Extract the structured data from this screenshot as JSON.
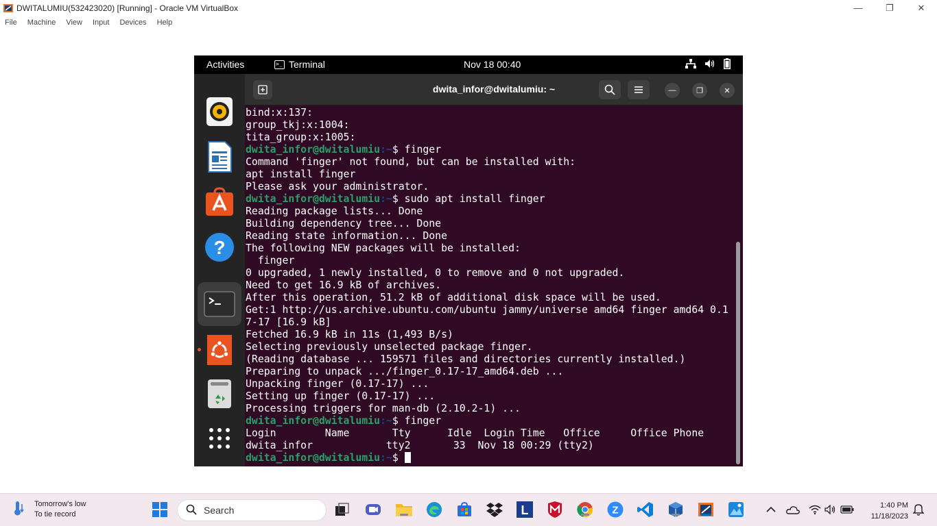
{
  "vbox": {
    "title": "DWITALUMIU(532423020) [Running] - Oracle VM VirtualBox",
    "menu": [
      "File",
      "Machine",
      "View",
      "Input",
      "Devices",
      "Help"
    ]
  },
  "gnome": {
    "activities": "Activities",
    "app_name": "Terminal",
    "clock": "Nov 18  00:40"
  },
  "terminal": {
    "title": "dwita_infor@dwitalumiu: ~",
    "prompt_user": "dwita_infor@dwitalumiu",
    "prompt_path": ":~",
    "prompt_symbol": "$ ",
    "lines": [
      {
        "type": "out",
        "text": "bind:x:137:"
      },
      {
        "type": "out",
        "text": "group_tkj:x:1004:"
      },
      {
        "type": "out",
        "text": "tita_group:x:1005:"
      },
      {
        "type": "cmd",
        "text": "finger"
      },
      {
        "type": "out",
        "text": "Command 'finger' not found, but can be installed with:"
      },
      {
        "type": "out",
        "text": "apt install finger"
      },
      {
        "type": "out",
        "text": "Please ask your administrator."
      },
      {
        "type": "cmd",
        "text": "sudo apt install finger"
      },
      {
        "type": "out",
        "text": "Reading package lists... Done"
      },
      {
        "type": "out",
        "text": "Building dependency tree... Done"
      },
      {
        "type": "out",
        "text": "Reading state information... Done"
      },
      {
        "type": "out",
        "text": "The following NEW packages will be installed:"
      },
      {
        "type": "out",
        "text": "  finger"
      },
      {
        "type": "out",
        "text": "0 upgraded, 1 newly installed, 0 to remove and 0 not upgraded."
      },
      {
        "type": "out",
        "text": "Need to get 16.9 kB of archives."
      },
      {
        "type": "out",
        "text": "After this operation, 51.2 kB of additional disk space will be used."
      },
      {
        "type": "out",
        "text": "Get:1 http://us.archive.ubuntu.com/ubuntu jammy/universe amd64 finger amd64 0.1"
      },
      {
        "type": "out",
        "text": "7-17 [16.9 kB]"
      },
      {
        "type": "out",
        "text": "Fetched 16.9 kB in 11s (1,493 B/s)"
      },
      {
        "type": "out",
        "text": "Selecting previously unselected package finger."
      },
      {
        "type": "out",
        "text": "(Reading database ... 159571 files and directories currently installed.)"
      },
      {
        "type": "out",
        "text": "Preparing to unpack .../finger_0.17-17_amd64.deb ..."
      },
      {
        "type": "out",
        "text": "Unpacking finger (0.17-17) ..."
      },
      {
        "type": "out",
        "text": "Setting up finger (0.17-17) ..."
      },
      {
        "type": "out",
        "text": "Processing triggers for man-db (2.10.2-1) ..."
      },
      {
        "type": "cmd",
        "text": "finger"
      },
      {
        "type": "out",
        "text": "Login        Name       Tty      Idle  Login Time   Office     Office Phone"
      },
      {
        "type": "out",
        "text": "dwita_infor            tty2       33  Nov 18 00:29 (tty2)"
      },
      {
        "type": "cur",
        "text": ""
      }
    ]
  },
  "taskbar": {
    "weather_line1": "Tomorrow's low",
    "weather_line2": "To tie record",
    "search_placeholder": "Search",
    "time": "1:40 PM",
    "date": "11/18/2023"
  },
  "colors": {
    "terminal_bg": "#300a24",
    "prompt_user": "#26a269",
    "prompt_path": "#12488b",
    "ubuntu_orange": "#e95420"
  }
}
